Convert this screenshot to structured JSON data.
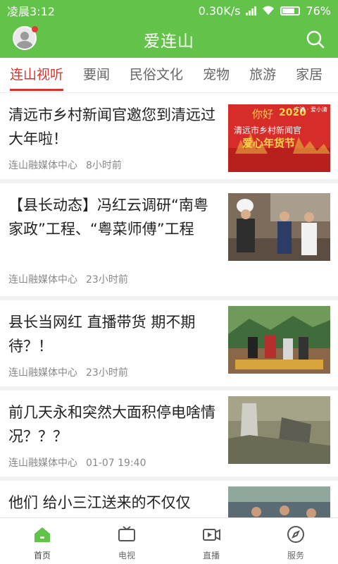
{
  "status": {
    "time": "凌晨3:12",
    "net_speed": "0.30K/s",
    "battery": "76%"
  },
  "header": {
    "title": "爱连山"
  },
  "tabs": [
    "连山视听",
    "要闻",
    "民俗文化",
    "宠物",
    "旅游",
    "家居"
  ],
  "active_tab": 0,
  "news": [
    {
      "title": "清远市乡村新闻官邀您到清远过大年啦！",
      "source": "连山融媒体中心",
      "time": "8小时前",
      "thumb_text": {
        "hello": "你好",
        "year": "2020",
        "line1": "清远市乡村新闻官",
        "line2": "爱心年货节",
        "brand": "广清 · 爱小清"
      }
    },
    {
      "title": "【县长动态】冯红云调研“南粤家政”工程、“粤菜师傅”工程",
      "source": "连山融媒体中心",
      "time": "23小时前"
    },
    {
      "title": "县长当网红 直播带货 期不期待？！",
      "source": "连山融媒体中心",
      "time": "23小时前"
    },
    {
      "title": "前几天永和突然大面积停电啥情况？？？",
      "source": "连山融媒体中心",
      "time": "01-07 19:40"
    },
    {
      "title": "他们 给小三江送来的不仅仅",
      "source": "",
      "time": ""
    }
  ],
  "bottom_nav": [
    {
      "label": "首页",
      "icon": "home-icon"
    },
    {
      "label": "电视",
      "icon": "tv-icon"
    },
    {
      "label": "直播",
      "icon": "live-video-icon"
    },
    {
      "label": "服务",
      "icon": "compass-icon"
    }
  ],
  "colors": {
    "brand_green": "#62c24a",
    "accent_red": "#d9352e"
  }
}
